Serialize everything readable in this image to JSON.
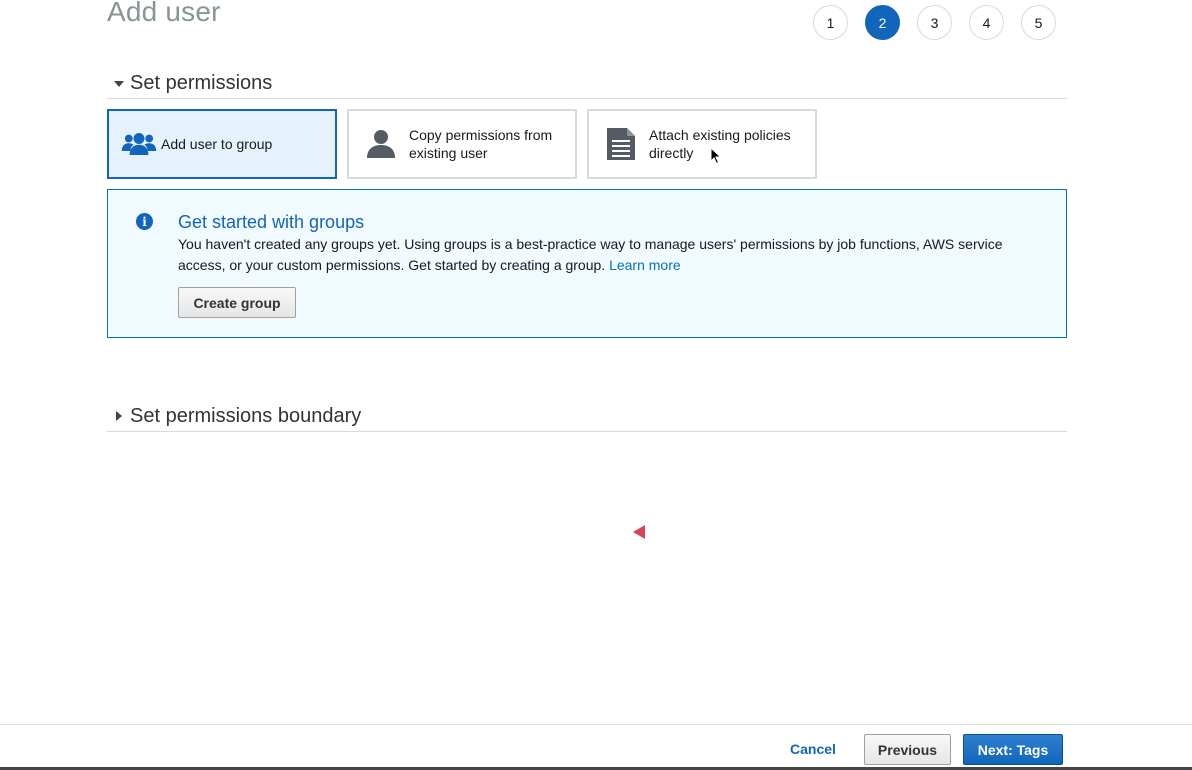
{
  "page": {
    "title": "Add user"
  },
  "steps": [
    {
      "label": "1",
      "active": false
    },
    {
      "label": "2",
      "active": true
    },
    {
      "label": "3",
      "active": false
    },
    {
      "label": "4",
      "active": false
    },
    {
      "label": "5",
      "active": false
    }
  ],
  "permissions": {
    "title": "Set permissions",
    "options": [
      {
        "label": "Add user to group",
        "icon": "users-group-icon",
        "selected": true
      },
      {
        "label": "Copy permissions from existing user",
        "icon": "user-icon",
        "selected": false
      },
      {
        "label": "Attach existing policies directly",
        "icon": "document-icon",
        "selected": false
      }
    ]
  },
  "info": {
    "title": "Get started with groups",
    "text": "You haven't created any groups yet. Using groups is a best-practice way to manage users' permissions by job functions, AWS service access, or your custom permissions. Get started by creating a group.",
    "link": "Learn more",
    "button": "Create group",
    "icon": "info-icon"
  },
  "boundary": {
    "title": "Set permissions boundary"
  },
  "footer": {
    "cancel": "Cancel",
    "previous": "Previous",
    "next": "Next: Tags"
  },
  "colors": {
    "accent": "#1166bb",
    "info_bg": "#f1faff",
    "marker": "#d9435a"
  }
}
